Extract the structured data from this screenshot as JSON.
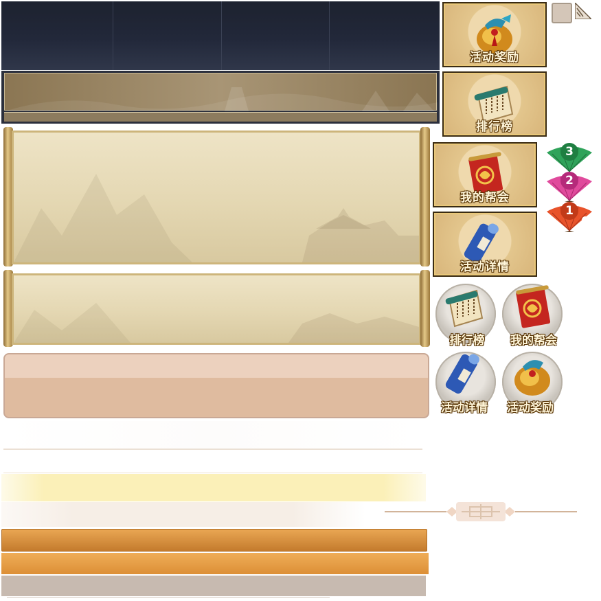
{
  "header": {
    "tab_count": 4,
    "colors": {
      "dark": "#1d222f",
      "brown": "#a08b66"
    }
  },
  "buttons": {
    "activity_reward": "活动奖励",
    "leaderboard": "排行榜",
    "my_guild": "我的帮会",
    "activity_details": "活动详情"
  },
  "round_buttons": {
    "leaderboard": "排行榜",
    "my_guild": "我的帮会",
    "activity_details": "活动详情",
    "activity_reward": "活动奖励"
  },
  "ranks": {
    "third": "3",
    "second": "2",
    "first": "1",
    "colors": {
      "third": "#2fa35a",
      "second": "#e04a9c",
      "first": "#e8532b"
    }
  },
  "icons": {
    "reward": "money-bag-icon",
    "leaderboard": "paper-scroll-icon",
    "guild": "red-banner-icon",
    "details": "blue-scroll-icon"
  }
}
